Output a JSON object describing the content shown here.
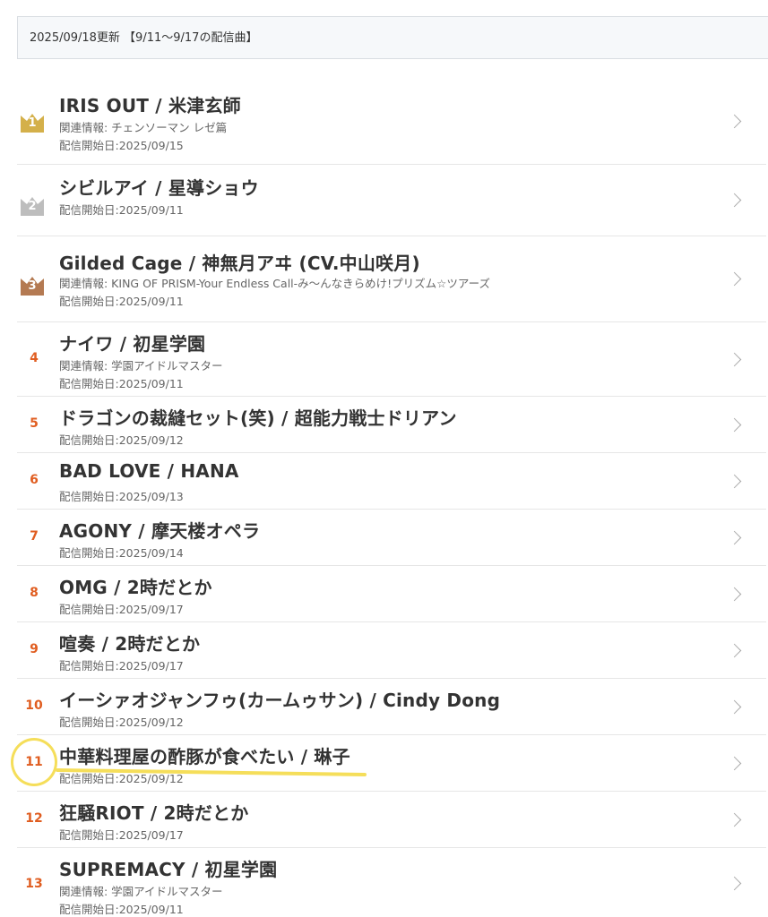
{
  "header": {
    "update_text": "2025/09/18更新 【9/11～9/17の配信曲】"
  },
  "colors": {
    "gold": "#d4b04a",
    "silver": "#bdbdbd",
    "bronze": "#b47a52",
    "rank_orange": "#e05d20",
    "highlight_yellow": "#f5de5a"
  },
  "ranking": [
    {
      "rank": "1",
      "icon": "gold-crown-icon",
      "title": "IRIS OUT  /  米津玄師",
      "related": "関連情報: チェンソーマン レゼ篇",
      "date": "配信開始日:2025/09/15"
    },
    {
      "rank": "2",
      "icon": "silver-crown-icon",
      "title": "シビルアイ  /  星導ショウ",
      "related": "",
      "date": "配信開始日:2025/09/11"
    },
    {
      "rank": "3",
      "icon": "bronze-crown-icon",
      "title": "Gilded Cage  /  神無月アヰ (CV.中山咲月)",
      "related": "関連情報: KING OF PRISM-Your Endless Call-み～んなきらめけ!プリズム☆ツアーズ",
      "date": "配信開始日:2025/09/11"
    },
    {
      "rank": "4",
      "title": "ナイワ  /  初星学園",
      "related": "関連情報: 学園アイドルマスター",
      "date": "配信開始日:2025/09/11"
    },
    {
      "rank": "5",
      "title": "ドラゴンの裁縫セット(笑)  /  超能力戦士ドリアン",
      "related": "",
      "date": "配信開始日:2025/09/12"
    },
    {
      "rank": "6",
      "title": "BAD LOVE  /  HANA",
      "related": "",
      "date": "配信開始日:2025/09/13"
    },
    {
      "rank": "7",
      "title": "AGONY  /  摩天楼オペラ",
      "related": "",
      "date": "配信開始日:2025/09/14"
    },
    {
      "rank": "8",
      "title": "OMG  /  2時だとか",
      "related": "",
      "date": "配信開始日:2025/09/17"
    },
    {
      "rank": "9",
      "title": "喧奏  /  2時だとか",
      "related": "",
      "date": "配信開始日:2025/09/17"
    },
    {
      "rank": "10",
      "title": "イーシァオジャンフゥ(カームゥサン)  /  Cindy Dong",
      "related": "",
      "date": "配信開始日:2025/09/12"
    },
    {
      "rank": "11",
      "title": "中華料理屋の酢豚が食べたい  /  琳子",
      "related": "",
      "date": "配信開始日:2025/09/12"
    },
    {
      "rank": "12",
      "title": "狂騒RIOT  /  2時だとか",
      "related": "",
      "date": "配信開始日:2025/09/17"
    },
    {
      "rank": "13",
      "title": "SUPREMACY  /  初星学園",
      "related": "関連情報: 学園アイドルマスター",
      "date": "配信開始日:2025/09/11"
    }
  ]
}
